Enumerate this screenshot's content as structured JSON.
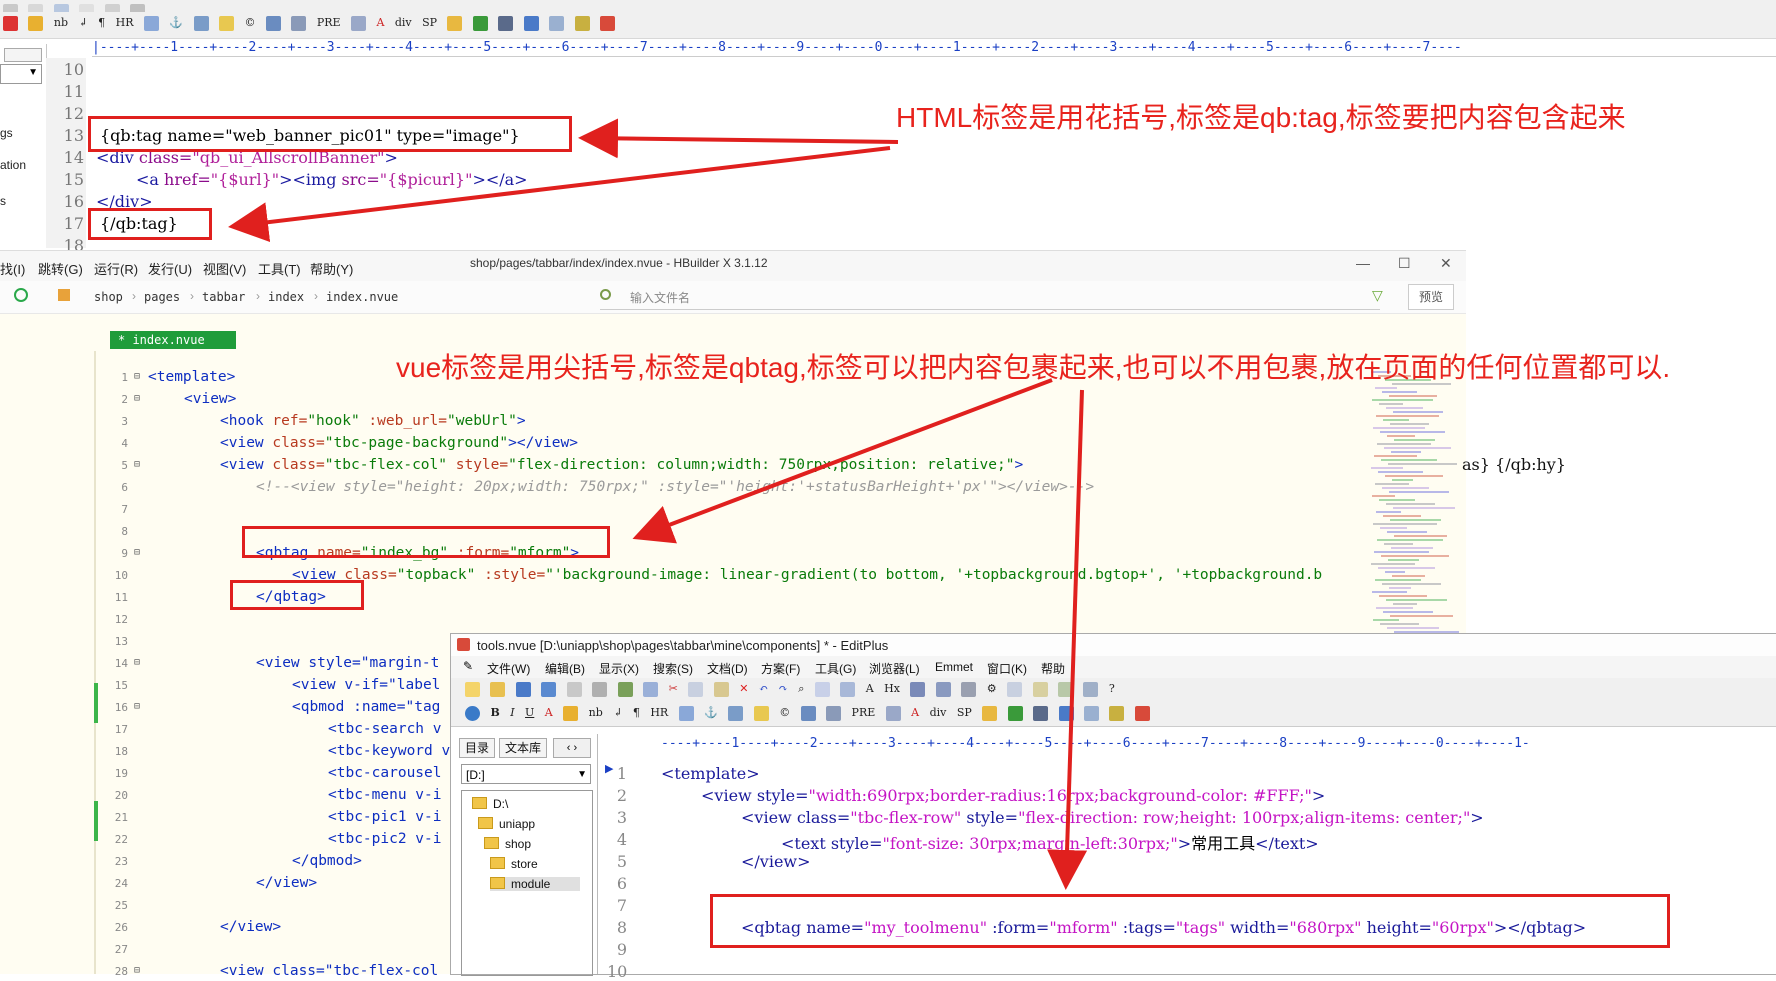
{
  "top_editor": {
    "line_numbers": [
      "10",
      "11",
      "12",
      "13",
      "14",
      "15",
      "16",
      "17",
      "18"
    ],
    "ruler": "|----+----1----+----2----+----3----+----4----+----5----+----6----+----7----+----8----+----9----+----0----+----1----+----2----+----3----+----4----+----5----+----6----+----7----",
    "code": {
      "l13": "{qb:tag name=\"web_banner_pic01\" type=\"image\"}",
      "l14_open": "<div ",
      "l14_attr": "class=",
      "l14_val": "\"qb_ui_AllscrollBanner\"",
      "l14_close": ">",
      "l15_a": "<a ",
      "l15_href": "href=",
      "l15_hval": "\"{$url}\"",
      "l15_gt": ">",
      "l15_img": "<img ",
      "l15_src": "src=",
      "l15_sval": "\"{$picurl}\"",
      "l15_end": "></a>",
      "l16": "</div>",
      "l17": "{/qb:tag}"
    },
    "left_labels": [
      "gs",
      "ation",
      "s"
    ]
  },
  "hbuilder": {
    "title": "shop/pages/tabbar/index/index.nvue - HBuilder X 3.1.12",
    "menus": [
      "找(I)",
      "跳转(G)",
      "运行(R)",
      "发行(U)",
      "视图(V)",
      "工具(T)",
      "帮助(Y)"
    ],
    "breadcrumbs": [
      "shop",
      "pages",
      "tabbar",
      "index",
      "index.nvue"
    ],
    "search_placeholder": "输入文件名",
    "preview_label": "预览",
    "tab_label": "* index.nvue",
    "line_numbers": [
      "1",
      "2",
      "3",
      "4",
      "5",
      "6",
      "7",
      "8",
      "9",
      "10",
      "11",
      "12",
      "13",
      "14",
      "15",
      "16",
      "17",
      "18",
      "19",
      "20",
      "21",
      "22",
      "23",
      "24",
      "25",
      "26",
      "27",
      "28"
    ],
    "code": {
      "l1": "<template>",
      "l2": "<view>",
      "l3_tag": "<hook ",
      "l3_a1": "ref=",
      "l3_v1": "\"hook\"",
      "l3_a2": " :web_url=",
      "l3_v2": "\"webUrl\"",
      "l3_end": ">",
      "l4_tag": "<view ",
      "l4_a": "class=",
      "l4_v": "\"tbc-page-background\"",
      "l4_end": "></view>",
      "l5_tag": "<view ",
      "l5_a": "class=",
      "l5_v": "\"tbc-flex-col\"",
      "l5_a2": " style=",
      "l5_v2": "\"flex-direction: column;width: 750rpx;position: relative;\"",
      "l5_end": ">",
      "l6": "<!--<view style=\"height: 20px;width: 750rpx;\" :style=\"'height:'+statusBarHeight+'px'\"></view>-->",
      "l9_tag": "<qbtag ",
      "l9_a": "name=",
      "l9_v": "\"index_bg\"",
      "l9_a2": " :form=",
      "l9_v2": "\"mform\"",
      "l9_end": ">",
      "l10_tag": "<view ",
      "l10_a": "class=",
      "l10_v": "\"topback\"",
      "l10_a2": " :style=",
      "l10_v2": "\"'background-image: linear-gradient(to bottom, '+topbackground.bgtop+', '+topbackground.b",
      "l11": "</qbtag>",
      "l14": "<view style=\"margin-t",
      "l15": "<view v-if=\"label",
      "l16": "<qbmod :name=\"tag",
      "l17": "<tbc-search v",
      "l18": "<tbc-keyword v",
      "l19": "<tbc-carousel",
      "l20": "<tbc-menu v-i",
      "l21": "<tbc-pic1 v-i",
      "l22": "<tbc-pic2 v-i",
      "l23": "</qbmod>",
      "l24": "</view>",
      "l26": "</view>",
      "l28": "<view class=\"tbc-flex-col"
    },
    "right_fragment": "as} {/qb:hy}"
  },
  "editplus": {
    "title": "tools.nvue [D:\\uniapp\\shop\\pages\\tabbar\\mine\\components] * - EditPlus",
    "menus": [
      "文件(W)",
      "编辑(B)",
      "显示(X)",
      "搜索(S)",
      "文档(D)",
      "方案(F)",
      "工具(G)",
      "浏览器(L)",
      "Emmet",
      "窗口(K)",
      "帮助"
    ],
    "side_tabs": [
      "目录",
      "文本库"
    ],
    "drive": "[D:]",
    "folders": [
      "D:\\",
      "uniapp",
      "shop",
      "store",
      "module"
    ],
    "ruler": "----+----1----+----2----+----3----+----4----+----5----+----6----+----7----+----8----+----9----+----0----+----1-",
    "line_numbers": [
      "1",
      "2",
      "3",
      "4",
      "5",
      "6",
      "7",
      "8",
      "9",
      "10"
    ],
    "code": {
      "l1": "<template>",
      "l2_tag": "<view ",
      "l2_a": "style=",
      "l2_v": "\"width:690rpx;border-radius:16rpx;background-color: #FFF;\"",
      "l2_end": ">",
      "l3_tag": "<view ",
      "l3_a": "class=",
      "l3_v": "\"tbc-flex-row\"",
      "l3_a2": " style=",
      "l3_v2": "\"flex-direction: row;height: 100rpx;align-items: center;\"",
      "l3_end": ">",
      "l4_tag": "<text ",
      "l4_a": "style=",
      "l4_v": "\"font-size: 30rpx;margin-left:30rpx;\"",
      "l4_gt": ">",
      "l4_txt": "常用工具",
      "l4_end": "</text>",
      "l5": "</view>",
      "l8_tag": "<qbtag ",
      "l8_a1": "name=",
      "l8_v1": "\"my_toolmenu\"",
      "l8_a2": " :form=",
      "l8_v2": "\"mform\"",
      "l8_a3": " :tags=",
      "l8_v3": "\"tags\"",
      "l8_a4": " width=",
      "l8_v4": "\"680rpx\"",
      "l8_a5": " height=",
      "l8_v5": "\"60rpx\"",
      "l8_end": "></qbtag>"
    }
  },
  "annotations": {
    "html_note": "HTML标签是用花括号,标签是qb:tag,标签要把内容包含起来",
    "vue_note": "vue标签是用尖括号,标签是qbtag,标签可以把内容包裹起来,也可以不用包裹,放在页面的任何位置都可以."
  },
  "colors": {
    "annotation_red": "#e8231d",
    "hb_tag": "#0e2ec1",
    "hb_string": "#0a7b0a",
    "ep_string": "#c414c4"
  }
}
